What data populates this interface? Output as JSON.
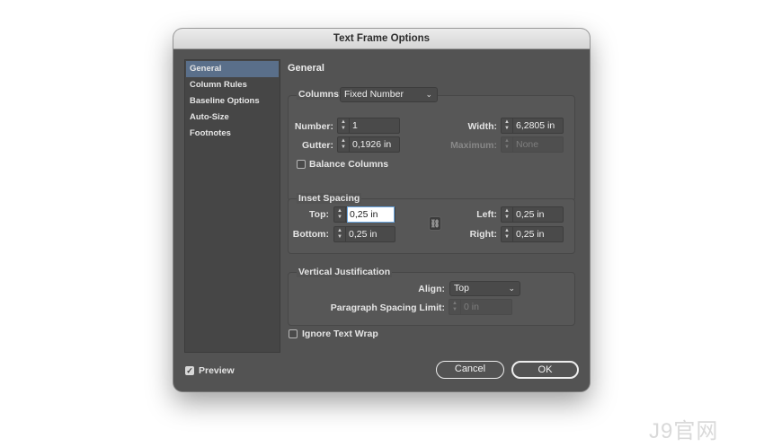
{
  "dialog": {
    "title": "Text Frame Options"
  },
  "sidebar": {
    "items": [
      {
        "label": "General",
        "selected": true
      },
      {
        "label": "Column Rules"
      },
      {
        "label": "Baseline Options"
      },
      {
        "label": "Auto-Size"
      },
      {
        "label": "Footnotes"
      }
    ]
  },
  "section_title": "General",
  "columns": {
    "label": "Columns:",
    "type_value": "Fixed Number",
    "number_label": "Number:",
    "number_value": "1",
    "gutter_label": "Gutter:",
    "gutter_value": "0,1926 in",
    "width_label": "Width:",
    "width_value": "6,2805 in",
    "maximum_label": "Maximum:",
    "maximum_value": "None",
    "balance_label": "Balance Columns",
    "balance_checked": false
  },
  "inset": {
    "title": "Inset Spacing",
    "top_label": "Top:",
    "top_value": "0,25 in",
    "bottom_label": "Bottom:",
    "bottom_value": "0,25 in",
    "left_label": "Left:",
    "left_value": "0,25 in",
    "right_label": "Right:",
    "right_value": "0,25 in"
  },
  "vertical": {
    "title": "Vertical Justification",
    "align_label": "Align:",
    "align_value": "Top",
    "para_label": "Paragraph Spacing Limit:",
    "para_value": "0 in"
  },
  "ignore_wrap": {
    "label": "Ignore Text Wrap",
    "checked": false
  },
  "preview": {
    "label": "Preview",
    "checked": true
  },
  "buttons": {
    "cancel": "Cancel",
    "ok": "OK"
  },
  "watermark": "J9官网"
}
